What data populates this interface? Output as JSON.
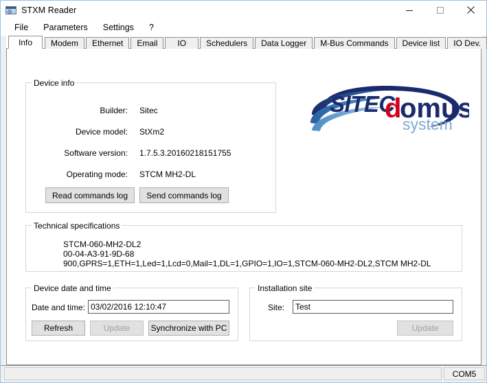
{
  "window": {
    "title": "STXM  Reader",
    "icon": "app-window-icon",
    "controls": {
      "minimize": "minimize-icon",
      "maximize": "maximize-icon",
      "close": "close-icon"
    }
  },
  "menubar": {
    "items": [
      {
        "label": "File"
      },
      {
        "label": "Parameters"
      },
      {
        "label": "Settings"
      },
      {
        "label": "?"
      }
    ]
  },
  "tabs": {
    "selected": "Info",
    "items": [
      {
        "label": "Info"
      },
      {
        "label": "Modem"
      },
      {
        "label": "Ethernet"
      },
      {
        "label": "Email"
      },
      {
        "label": "IO"
      },
      {
        "label": "Schedulers"
      },
      {
        "label": "Data Logger"
      },
      {
        "label": "M-Bus Commands"
      },
      {
        "label": "Device list"
      },
      {
        "label": "IO Dev."
      }
    ]
  },
  "device_info": {
    "legend": "Device info",
    "fields": [
      {
        "label": "Builder:",
        "value": "Sitec"
      },
      {
        "label": "Device model:",
        "value": "StXm2"
      },
      {
        "label": "Software version:",
        "value": "1.7.5.3.20160218151755"
      },
      {
        "label": "Operating mode:",
        "value": "STCM MH2-DL"
      }
    ],
    "read_log_button": "Read commands log",
    "send_log_button": "Send commands log"
  },
  "logo": {
    "brand_primary": "SITEC",
    "brand_accent": "d",
    "brand_secondary": "omus",
    "brand_tagline": "system",
    "color_navy": "#1b2a6b",
    "color_red": "#d0021b",
    "color_lightblue": "#7fa8cf",
    "color_midblue": "#2a6bb0"
  },
  "technical_specifications": {
    "legend": "Technical specifications",
    "lines": [
      "STCM-060-MH2-DL2",
      "00-04-A3-91-9D-68",
      "900,GPRS=1,ETH=1,Led=1,Lcd=0,Mail=1,DL=1,GPIO=1,IO=1,STCM-060-MH2-DL2,STCM MH2-DL"
    ]
  },
  "device_date_time": {
    "legend": "Device date and time",
    "field_label": "Date and time:",
    "field_value": "03/02/2016 12:10:47",
    "refresh_button": "Refresh",
    "update_button": "Update",
    "sync_button": "Synchronize with PC"
  },
  "installation_site": {
    "legend": "Installation site",
    "field_label": "Site:",
    "field_value": "Test",
    "update_button": "Update"
  },
  "statusbar": {
    "port": "COM5"
  }
}
